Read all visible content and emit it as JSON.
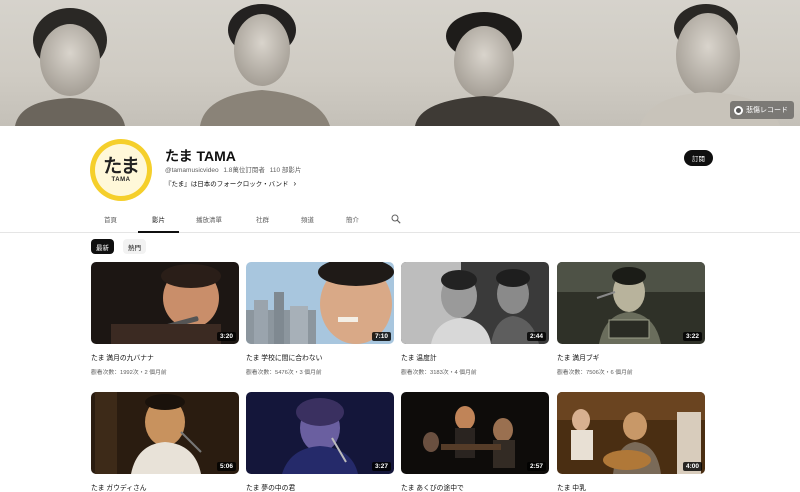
{
  "banner": {
    "link_label": "悲傷レコード"
  },
  "channel": {
    "avatar_text": "たま",
    "avatar_sub": "TAMA",
    "name": "たま TAMA",
    "handle": "@tamamusicvideo",
    "subscribers": "1.8萬位訂閱者",
    "video_count": "110 部影片",
    "description": "『たま』は日本のフォークロック・バンド",
    "subscribe_label": "訂閱"
  },
  "tabs": [
    {
      "label": "首頁"
    },
    {
      "label": "影片"
    },
    {
      "label": "播放清單"
    },
    {
      "label": "社群"
    },
    {
      "label": "頻道"
    },
    {
      "label": "簡介"
    }
  ],
  "chips": [
    {
      "label": "最新"
    },
    {
      "label": "熱門"
    }
  ],
  "videos": [
    {
      "title": "たま 満月の九バナナ",
      "meta": "觀看次數：1992次・2 個月前",
      "duration": "3:20"
    },
    {
      "title": "たま 学校に間に合わない",
      "meta": "觀看次數：5476次・3 個月前",
      "duration": "7:10"
    },
    {
      "title": "たま 温度計",
      "meta": "觀看次數：3183次・4 個月前",
      "duration": "2:44"
    },
    {
      "title": "たま 満月ブギ",
      "meta": "觀看次數：7506次・6 個月前",
      "duration": "3:22"
    },
    {
      "title": "たま ガウディさん",
      "meta": "",
      "duration": "5:06"
    },
    {
      "title": "たま 夢の中の君",
      "meta": "",
      "duration": "3:27"
    },
    {
      "title": "たま あくびの途中で",
      "meta": "",
      "duration": "2:57"
    },
    {
      "title": "たま 中乳",
      "meta": "",
      "duration": "4:00"
    }
  ],
  "icons": {
    "search": "search-icon",
    "chevron": "chevron-right-icon",
    "record": "record-icon"
  }
}
